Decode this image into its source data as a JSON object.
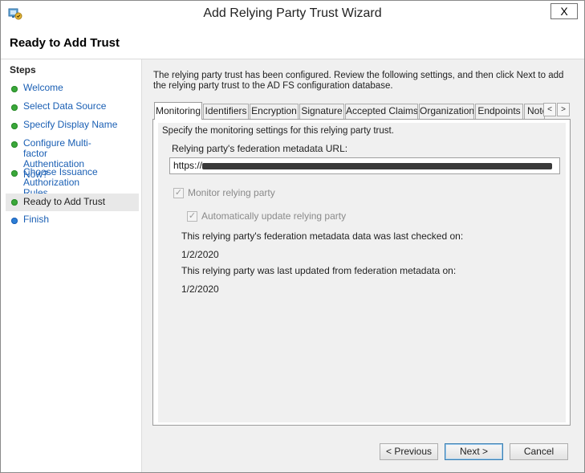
{
  "window": {
    "title": "Add Relying Party Trust Wizard",
    "close_label": "X",
    "icon": "adfs-wizard-icon"
  },
  "header": {
    "page_title": "Ready to Add Trust"
  },
  "steps": {
    "heading": "Steps",
    "items": [
      {
        "label": "Welcome",
        "state": "done"
      },
      {
        "label": "Select Data Source",
        "state": "done"
      },
      {
        "label": "Specify Display Name",
        "state": "done"
      },
      {
        "label": "Configure Multi-factor Authentication Now?",
        "state": "done"
      },
      {
        "label": "Choose Issuance Authorization Rules",
        "state": "done"
      },
      {
        "label": "Ready to Add Trust",
        "state": "current"
      },
      {
        "label": "Finish",
        "state": "pending"
      }
    ]
  },
  "main": {
    "intro": "The relying party trust has been configured. Review the following settings, and then click Next to add the relying party trust to the AD FS configuration database.",
    "tabs": [
      {
        "label": "Monitoring",
        "active": true
      },
      {
        "label": "Identifiers",
        "active": false
      },
      {
        "label": "Encryption",
        "active": false
      },
      {
        "label": "Signature",
        "active": false
      },
      {
        "label": "Accepted Claims",
        "active": false
      },
      {
        "label": "Organization",
        "active": false
      },
      {
        "label": "Endpoints",
        "active": false
      },
      {
        "label": "Note",
        "active": false
      }
    ],
    "tab_scroll_left": "<",
    "tab_scroll_right": ">",
    "monitoring": {
      "description": "Specify the monitoring settings for this relying party trust.",
      "url_label": "Relying party's federation metadata URL:",
      "url_value": "https://",
      "monitor_label": "Monitor relying party",
      "monitor_checked": true,
      "auto_update_label": "Automatically update relying party",
      "auto_update_checked": true,
      "last_checked_label": "This relying party's federation metadata data was last checked on:",
      "last_checked_value": "1/2/2020",
      "last_updated_label": "This relying party was last updated from federation metadata on:",
      "last_updated_value": "1/2/2020"
    }
  },
  "buttons": {
    "previous": "< Previous",
    "next": "Next >",
    "cancel": "Cancel"
  },
  "colors": {
    "link": "#1a5fb4",
    "step_done": "#3aa83a",
    "step_pending": "#2d7fd6",
    "current_step_bg": "#e8e8e8"
  }
}
